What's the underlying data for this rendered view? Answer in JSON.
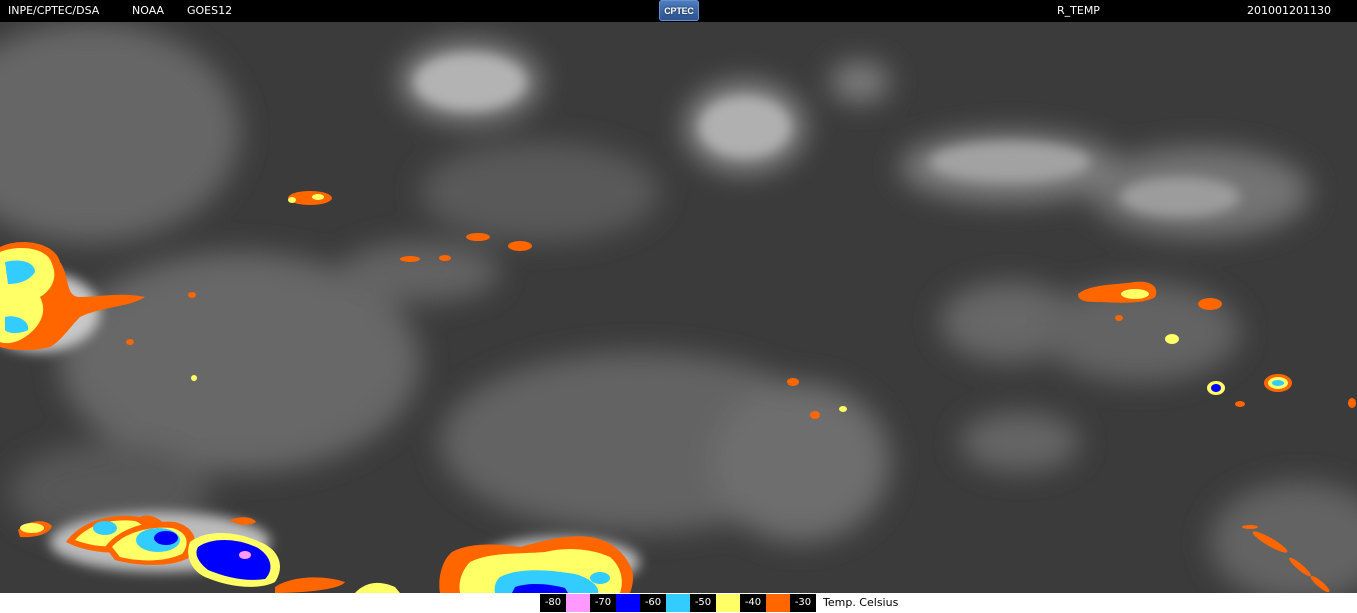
{
  "header": {
    "organization": "INPE/CPTEC/DSA",
    "agency": "NOAA",
    "satellite": "GOES12",
    "logo_text": "CPTEC",
    "product": "R_TEMP",
    "timestamp": "201001201130"
  },
  "legend": {
    "unit_label": "Temp. Celsius",
    "entries": [
      {
        "label": "-80",
        "color": "#ff99ff"
      },
      {
        "label": "-70",
        "color": "#0000ff"
      },
      {
        "label": "-60",
        "color": "#33ccff"
      },
      {
        "label": "-50",
        "color": "#ffff66"
      },
      {
        "label": "-40",
        "color": "#ff6600"
      },
      {
        "label": "-30",
        "color": null
      }
    ]
  },
  "colors": {
    "background_ocean": "#3a3a3a",
    "cloud": "#8c8c8c",
    "cloud_bright": "#b5b5b5"
  }
}
